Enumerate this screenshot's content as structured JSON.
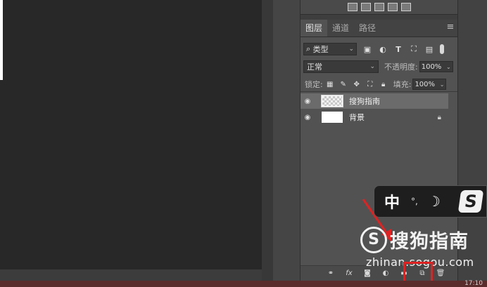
{
  "tabs": [
    {
      "label": "图层"
    },
    {
      "label": "通道"
    },
    {
      "label": "路径"
    }
  ],
  "panel_menu": "≡",
  "filter": {
    "kind_label": "类型",
    "icons": [
      "image-filter-icon",
      "adjustment-filter-icon",
      "type-filter-icon",
      "shape-filter-icon",
      "smart-object-filter-icon",
      "filter-toggle"
    ]
  },
  "blend": {
    "mode": "正常",
    "opacity_label": "不透明度:",
    "opacity_value": "100%"
  },
  "lock": {
    "label": "锁定:",
    "fill_label": "填充:",
    "fill_value": "100%"
  },
  "layers": [
    {
      "name": "搜狗指南",
      "selected": true,
      "visible": true,
      "thumbnail": "transparent"
    },
    {
      "name": "背景",
      "selected": false,
      "visible": true,
      "thumbnail": "white",
      "locked": true
    }
  ],
  "ime": {
    "mode": "中",
    "punct": "°,",
    "logo": "S"
  },
  "watermark": {
    "title": "搜狗指南",
    "url": "zhinan.sogou.com",
    "logo": "S"
  },
  "status": {
    "text": "17:10"
  },
  "colors": {
    "highlight": "#e02222",
    "arrow": "#e02222"
  }
}
